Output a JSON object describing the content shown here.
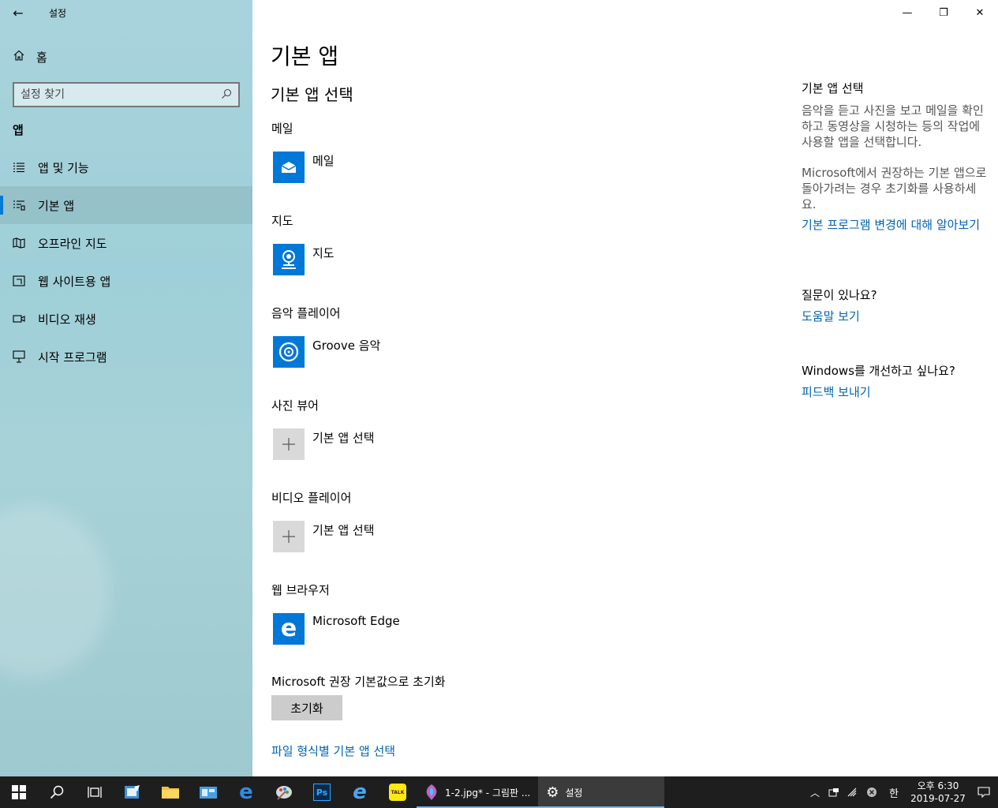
{
  "window": {
    "title": "설정",
    "back_glyph": "←",
    "min_glyph": "—",
    "restore_glyph": "❐",
    "close_glyph": "✕"
  },
  "sidebar": {
    "home_label": "홈",
    "search_placeholder": "설정 찾기",
    "section": "앱",
    "items": [
      {
        "label": "앱 및 기능",
        "icon": "apps-features-icon"
      },
      {
        "label": "기본 앱",
        "icon": "default-apps-icon",
        "active": true
      },
      {
        "label": "오프라인 지도",
        "icon": "offline-maps-icon"
      },
      {
        "label": "웹 사이트용 앱",
        "icon": "apps-for-websites-icon"
      },
      {
        "label": "비디오 재생",
        "icon": "video-playback-icon"
      },
      {
        "label": "시작 프로그램",
        "icon": "startup-icon"
      }
    ]
  },
  "main": {
    "title": "기본 앱",
    "subtitle": "기본 앱 선택",
    "categories": [
      {
        "label": "메일",
        "app": "메일",
        "icon": "mail-icon"
      },
      {
        "label": "지도",
        "app": "지도",
        "icon": "maps-icon"
      },
      {
        "label": "음악 플레이어",
        "app": "Groove 음악",
        "icon": "groove-music-icon"
      },
      {
        "label": "사진 뷰어",
        "app": "기본 앱 선택",
        "icon": "plus-icon"
      },
      {
        "label": "비디오 플레이어",
        "app": "기본 앱 선택",
        "icon": "plus-icon"
      },
      {
        "label": "웹 브라우저",
        "app": "Microsoft Edge",
        "icon": "edge-icon"
      }
    ],
    "reset_label": "Microsoft 권장 기본값으로 초기화",
    "reset_button": "초기화",
    "filetype_link": "파일 형식별 기본 앱 선택"
  },
  "aside": {
    "heading": "기본 앱 선택",
    "desc": "음악을 듣고 사진을 보고 메일을 확인하고 동영상을 시청하는 등의 작업에 사용할 앱을 선택합니다.",
    "reset_desc": "Microsoft에서 권장하는 기본 앱으로 돌아가려는 경우 초기화를 사용하세요.",
    "learn_link": "기본 프로그램 변경에 대해 알아보기",
    "question": "질문이 있나요?",
    "help_link": "도움말 보기",
    "improve": "Windows를 개선하고 싶나요?",
    "feedback_link": "피드백 보내기"
  },
  "taskbar": {
    "apps": [
      {
        "label": "1-2.jpg* - 그림판 ...",
        "icon": "paint-icon"
      },
      {
        "label": "설정",
        "icon": "settings-gear-icon",
        "active": true
      }
    ],
    "ime": "한",
    "time": "오후 6:30",
    "date": "2019-07-27"
  },
  "colors": {
    "accent": "#0078d7",
    "link": "#0063b1",
    "taskbar": "#1e1e1e"
  }
}
